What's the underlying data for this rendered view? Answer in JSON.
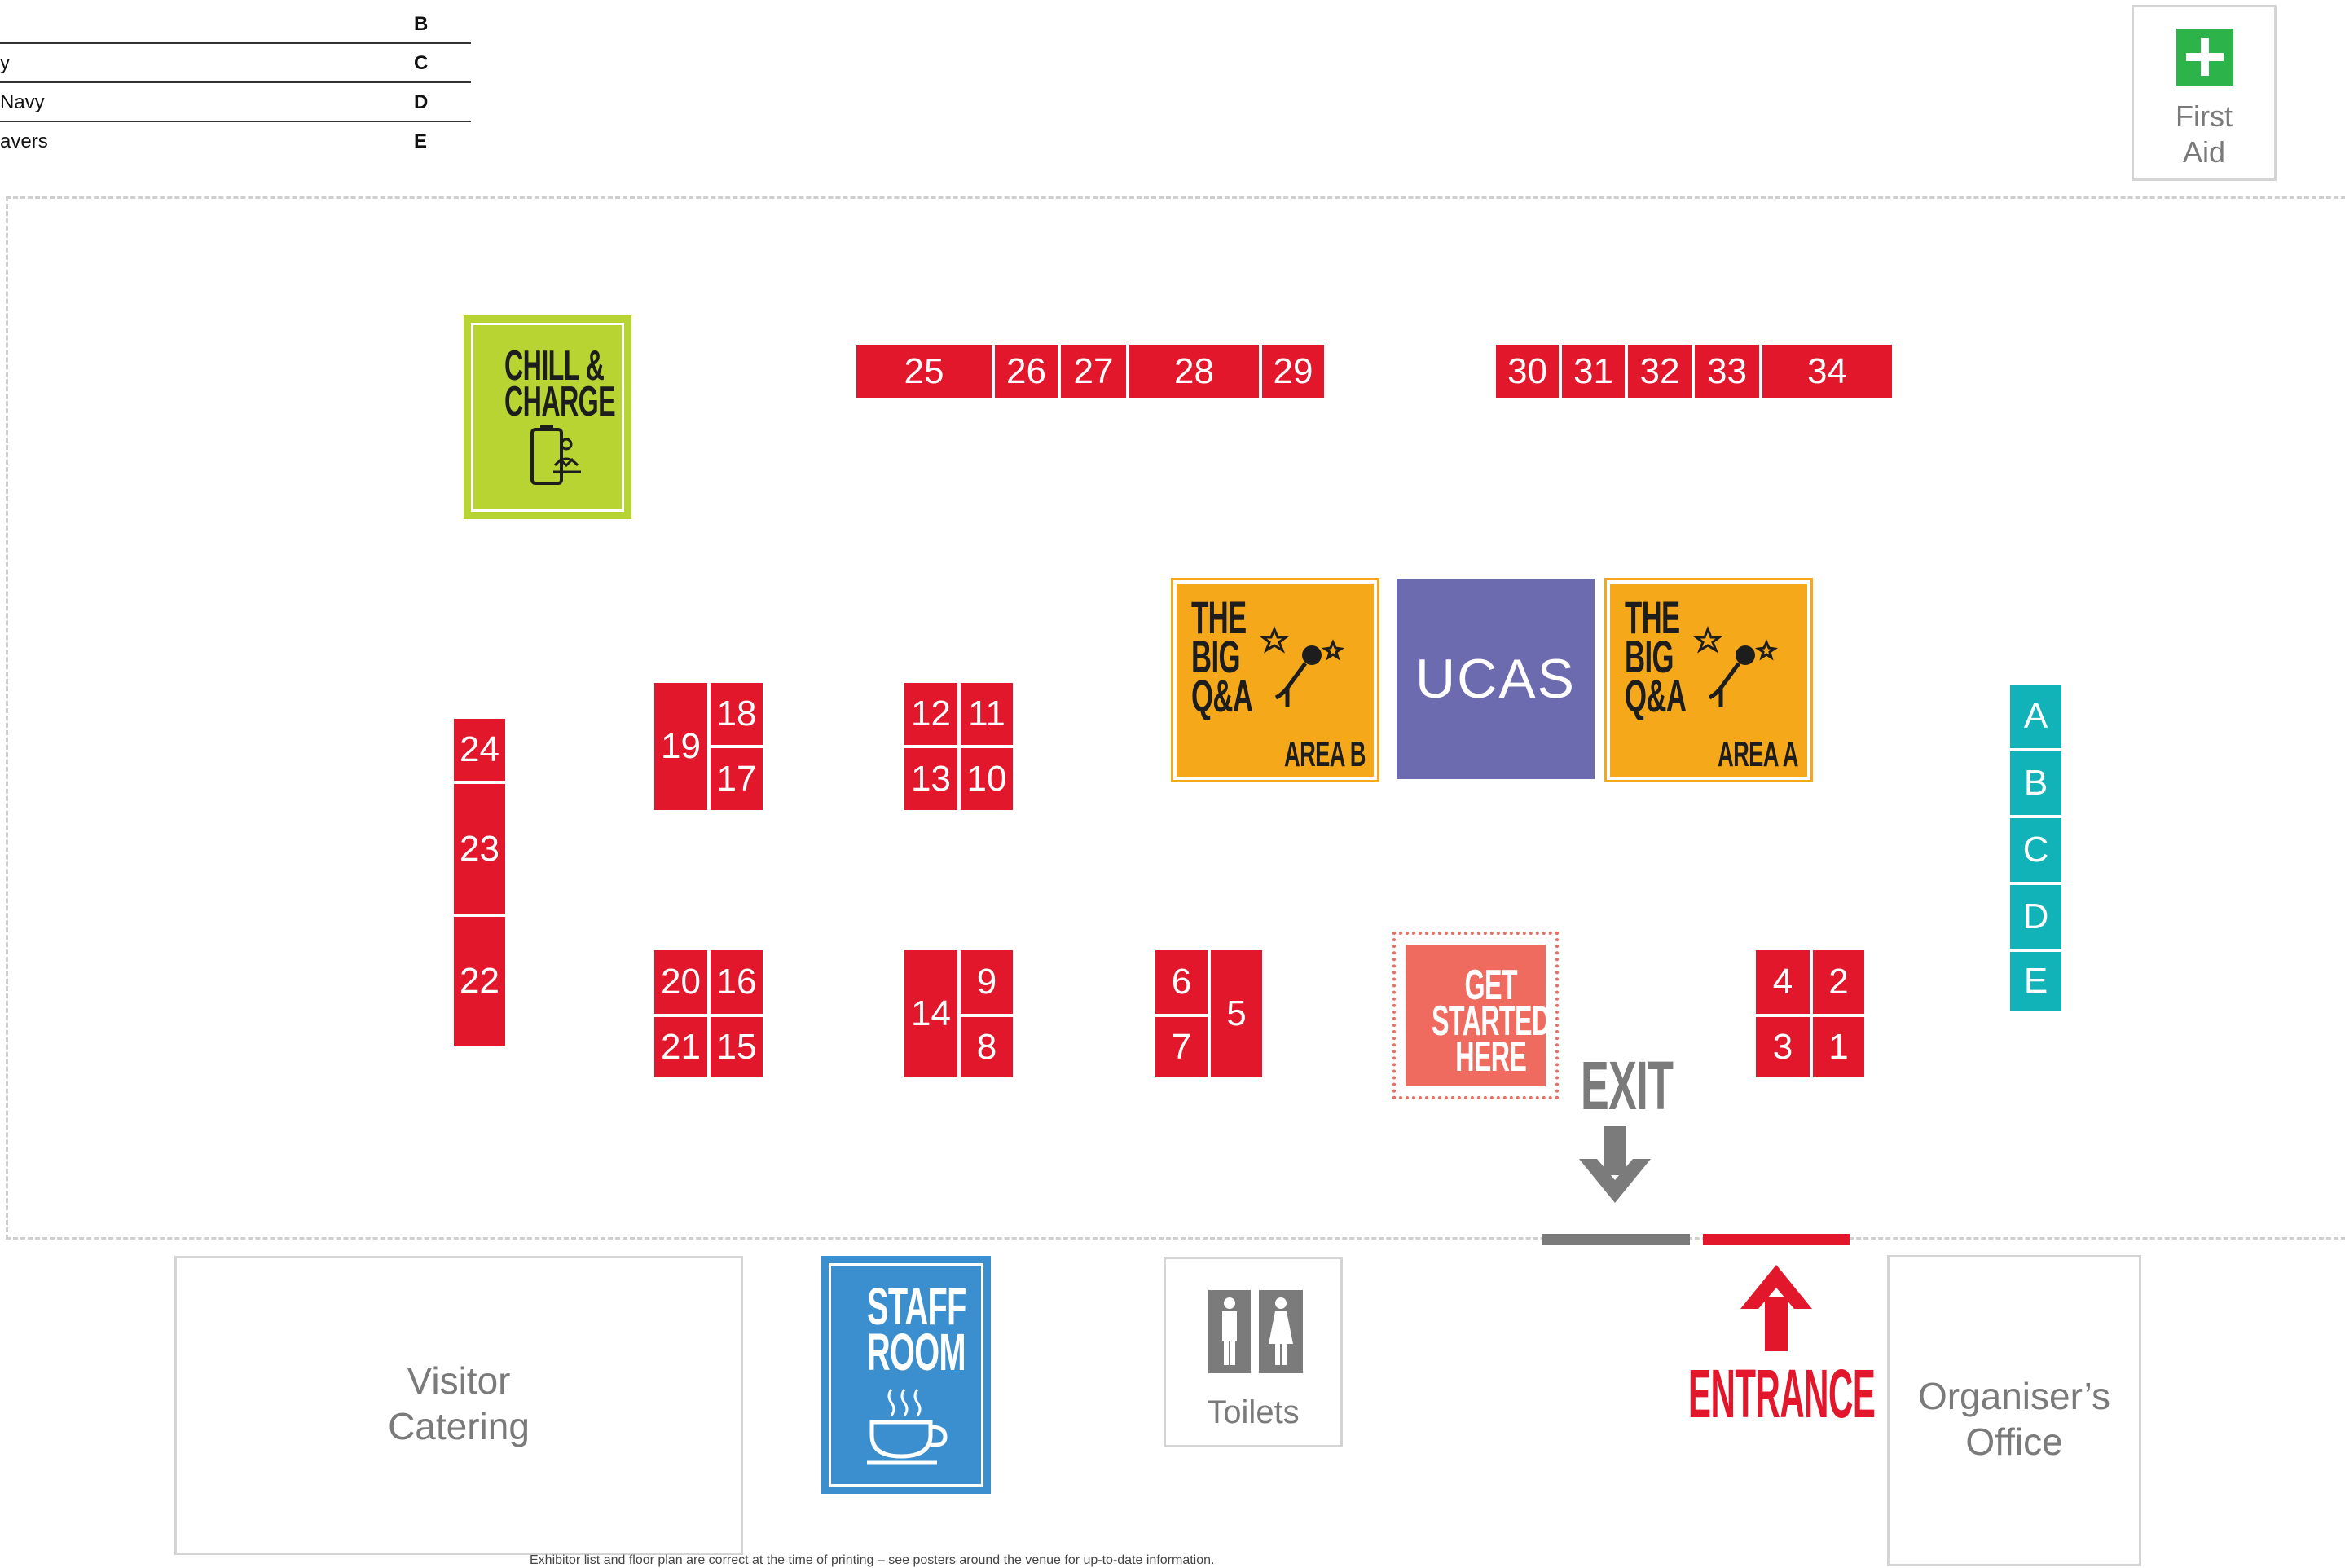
{
  "legend": [
    {
      "name": "",
      "code": "B"
    },
    {
      "name": "y",
      "code": "C"
    },
    {
      "name": "Navy",
      "code": "D"
    },
    {
      "name": "avers",
      "code": "E"
    }
  ],
  "first_aid": {
    "label": "First\nAid"
  },
  "features": {
    "chill_charge": "CHILL &\nCHARGE",
    "ucas": "UCAS",
    "big_qa_b": {
      "title": "THE\nBIG\nQ&A",
      "area": "AREA B"
    },
    "big_qa_a": {
      "title": "THE\nBIG\nQ&A",
      "area": "AREA A"
    },
    "get_started": "GET\nSTARTED\nHERE",
    "exit": "EXIT",
    "entrance": "ENTRANCE",
    "staff_room": "STAFF\nROOM"
  },
  "rooms": {
    "visitor_catering": "Visitor\nCatering",
    "toilets": "Toilets",
    "organisers_office": "Organiser’s\nOffice"
  },
  "stands": [
    "1",
    "2",
    "3",
    "4",
    "5",
    "6",
    "7",
    "8",
    "9",
    "10",
    "11",
    "12",
    "13",
    "14",
    "15",
    "16",
    "17",
    "18",
    "19",
    "20",
    "21",
    "22",
    "23",
    "24",
    "25",
    "26",
    "27",
    "28",
    "29",
    "30",
    "31",
    "32",
    "33",
    "34"
  ],
  "info_stands": [
    "A",
    "B",
    "C",
    "D",
    "E"
  ],
  "colors": {
    "stand_red": "#e2172b",
    "info_teal": "#11b3b9",
    "chill_green": "#b8d432",
    "qa_orange": "#f5a91a",
    "ucas_purple": "#6c6bb0",
    "get_started_salmon": "#ef6b5f",
    "staff_blue": "#3b8fce",
    "exit_grey": "#7b7b7b",
    "first_aid_green": "#2cb34a"
  },
  "footer_note": "Exhibitor list and floor plan are correct at the time of printing – see posters around the venue for up-to-date information."
}
